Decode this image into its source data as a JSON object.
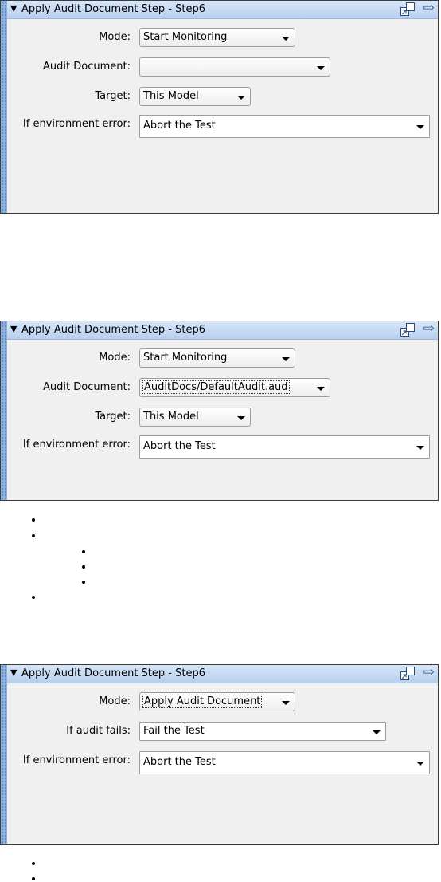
{
  "panels": [
    {
      "title": "Apply Audit Document Step - Step6",
      "rows": [
        {
          "label": "Mode:",
          "value": "Start Monitoring"
        },
        {
          "label": "Audit Document:",
          "value": ""
        },
        {
          "label": "Target:",
          "value": "This Model"
        },
        {
          "label": "If environment error:",
          "value": "Abort the Test"
        }
      ]
    },
    {
      "title": "Apply Audit Document Step - Step6",
      "rows": [
        {
          "label": "Mode:",
          "value": "Start Monitoring"
        },
        {
          "label": "Audit Document:",
          "value": "AuditDocs/DefaultAudit.aud"
        },
        {
          "label": "Target:",
          "value": "This Model"
        },
        {
          "label": "If environment error:",
          "value": "Abort the Test"
        }
      ]
    },
    {
      "title": "Apply Audit Document Step - Step6",
      "rows": [
        {
          "label": "Mode:",
          "value": "Apply Audit Document"
        },
        {
          "label": "If audit fails:",
          "value": "Fail the Test"
        },
        {
          "label": "If environment error:",
          "value": "Abort the Test"
        }
      ]
    }
  ],
  "icons": {
    "collapse": "triangle-down-icon",
    "float": "float-window-icon",
    "next": "arrow-right-icon"
  },
  "colors": {
    "title_bar": "#c6daf3",
    "stripe": "#8fb0d8",
    "panel_bg": "#f0f0f0"
  }
}
